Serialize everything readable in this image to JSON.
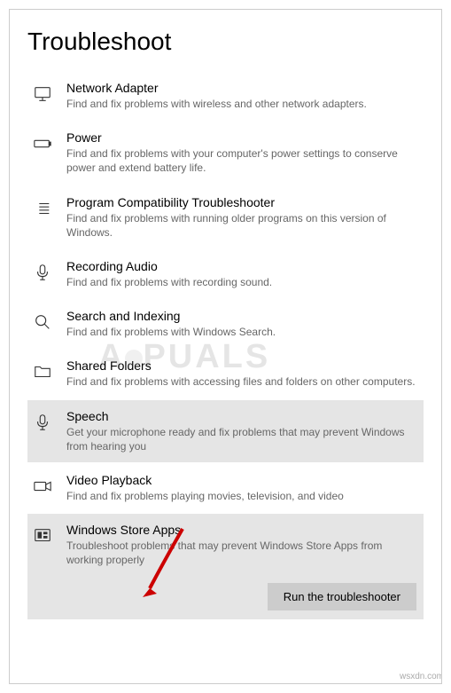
{
  "page_title": "Troubleshoot",
  "items": [
    {
      "title": "Network Adapter",
      "desc": "Find and fix problems with wireless and other network adapters.",
      "selected": false,
      "icon": "monitor"
    },
    {
      "title": "Power",
      "desc": "Find and fix problems with your computer's power settings to conserve power and extend battery life.",
      "selected": false,
      "icon": "battery"
    },
    {
      "title": "Program Compatibility Troubleshooter",
      "desc": "Find and fix problems with running older programs on this version of Windows.",
      "selected": false,
      "icon": "list"
    },
    {
      "title": "Recording Audio",
      "desc": "Find and fix problems with recording sound.",
      "selected": false,
      "icon": "mic"
    },
    {
      "title": "Search and Indexing",
      "desc": "Find and fix problems with Windows Search.",
      "selected": false,
      "icon": "search"
    },
    {
      "title": "Shared Folders",
      "desc": "Find and fix problems with accessing files and folders on other computers.",
      "selected": false,
      "icon": "folder"
    },
    {
      "title": "Speech",
      "desc": "Get your microphone ready and fix problems that may prevent Windows from hearing you",
      "selected": true,
      "icon": "mic"
    },
    {
      "title": "Video Playback",
      "desc": "Find and fix problems playing movies, television, and video",
      "selected": false,
      "icon": "video"
    },
    {
      "title": "Windows Store Apps",
      "desc": "Troubleshoot problems that may prevent Windows Store Apps from working properly",
      "selected": true,
      "icon": "store"
    }
  ],
  "run_button_label": "Run the troubleshooter",
  "watermark_text": "APPUALS",
  "attribution": "wsxdn.com"
}
